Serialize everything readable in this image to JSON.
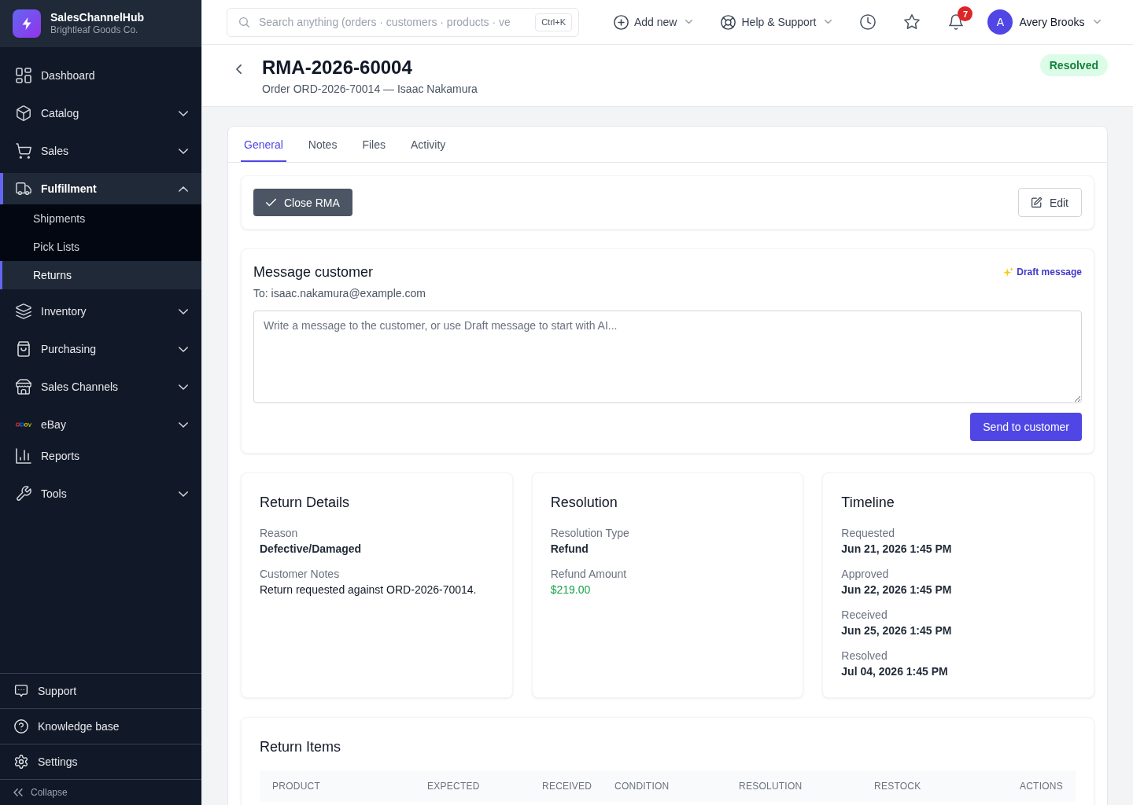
{
  "sidebar": {
    "brand": {
      "name": "SalesChannelHub",
      "subtitle": "Brightleaf Goods Co."
    },
    "items": [
      {
        "label": "Dashboard",
        "selected": false
      },
      {
        "label": "Catalog",
        "selected": false,
        "expanded": false
      },
      {
        "label": "Sales",
        "selected": false,
        "expanded": false
      },
      {
        "label": "Fulfillment",
        "selected": true,
        "expanded": true,
        "children": [
          {
            "label": "Shipments",
            "selected": false
          },
          {
            "label": "Pick Lists",
            "selected": false
          },
          {
            "label": "Returns",
            "selected": true
          }
        ]
      },
      {
        "label": "Inventory",
        "selected": false,
        "expanded": false
      },
      {
        "label": "Purchasing",
        "selected": false,
        "expanded": false
      },
      {
        "label": "Sales Channels",
        "selected": false,
        "expanded": false
      },
      {
        "label": "eBay",
        "selected": false,
        "expanded": false
      },
      {
        "label": "Reports",
        "selected": false
      },
      {
        "label": "Tools",
        "selected": false,
        "expanded": false
      }
    ],
    "footer_items": [
      {
        "label": "Support"
      },
      {
        "label": "Knowledge base"
      },
      {
        "label": "Settings"
      }
    ],
    "collapse": {
      "label": "Collapse"
    }
  },
  "top_bar": {
    "search": {
      "placeholder": "Search anything (orders · customers · products · ve",
      "shortcut": "Ctrl+K"
    },
    "menus": [
      {
        "label": "Add new"
      },
      {
        "label": "Help & Support"
      }
    ],
    "notifications": {
      "count": "7"
    },
    "user": {
      "initial": "A",
      "name": "Avery Brooks"
    }
  },
  "page_header": {
    "title": "RMA-2026-60004",
    "subtitle": "Order ORD-2026-70014 — Isaac Nakamura",
    "status": "Resolved"
  },
  "tabs": [
    {
      "label": "General",
      "selected": true
    },
    {
      "label": "Notes",
      "selected": false
    },
    {
      "label": "Files",
      "selected": false
    },
    {
      "label": "Activity",
      "selected": false
    }
  ],
  "actions": {
    "close": "Close RMA",
    "edit": "Edit"
  },
  "message": {
    "title": "Message customer",
    "draft_link": "Draft message",
    "recipient": "To: isaac.nakamura@example.com",
    "placeholder": "Write a message to the customer, or use Draft message to start with AI...",
    "send": "Send to customer"
  },
  "panels": [
    {
      "title": "Return Details",
      "fields": [
        {
          "label": "Reason",
          "value": "Defective/Damaged",
          "kind": "strong"
        },
        {
          "label": "Customer Notes",
          "value": "Return requested against ORD-2026-70014.",
          "kind": "plain"
        }
      ]
    },
    {
      "title": "Resolution",
      "fields": [
        {
          "label": "Resolution Type",
          "value": "Refund",
          "kind": "strong"
        },
        {
          "label": "Refund Amount",
          "value": "$219.00",
          "kind": "money"
        }
      ]
    },
    {
      "title": "Timeline",
      "fields": [
        {
          "label": "Requested",
          "value": "Jun 21, 2026 1:45 PM",
          "kind": "strong"
        },
        {
          "label": "Approved",
          "value": "Jun 22, 2026 1:45 PM",
          "kind": "strong"
        },
        {
          "label": "Received",
          "value": "Jun 25, 2026 1:45 PM",
          "kind": "strong"
        },
        {
          "label": "Resolved",
          "value": "Jul 04, 2026 1:45 PM",
          "kind": "strong"
        }
      ]
    }
  ],
  "return_items": {
    "title": "Return Items",
    "table": {
      "columns": [
        "PRODUCT",
        "EXPECTED",
        "RECEIVED",
        "CONDITION",
        "RESOLUTION",
        "RESTOCK",
        "ACTIONS"
      ]
    }
  }
}
